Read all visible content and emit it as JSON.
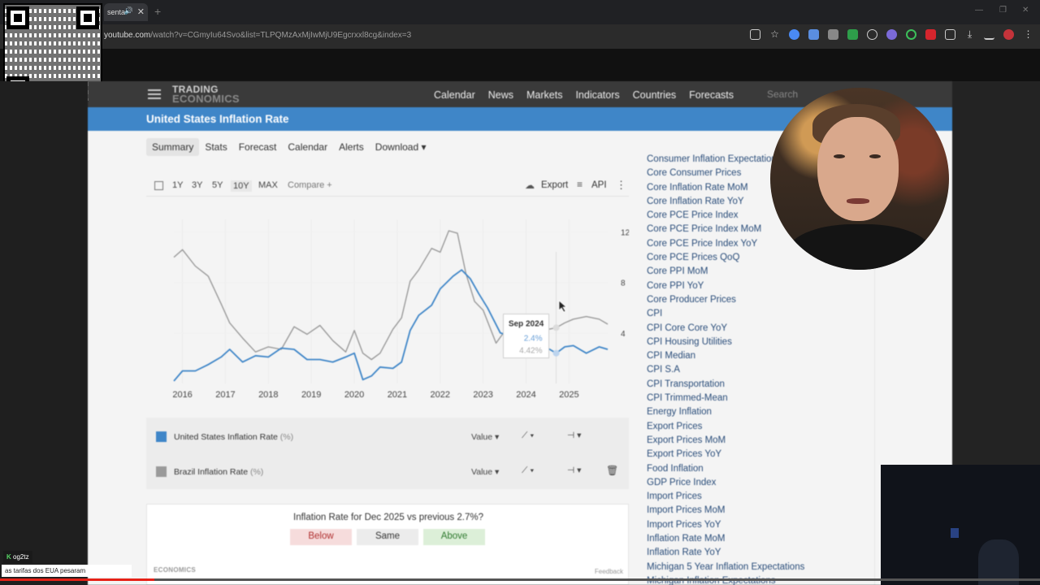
{
  "browser": {
    "tab_title": "senta",
    "url_host": "youtube.com",
    "url_path": "/watch?v=CGmyIu64Svo&list=TLPQMzAxMjIwMjU9Egcrxxl8cg&index=3"
  },
  "site": {
    "logo_line1": "TRADING",
    "logo_line2": "ECONOMICS",
    "nav": [
      "Calendar",
      "News",
      "Markets",
      "Indicators",
      "Countries",
      "Forecasts"
    ],
    "search_placeholder": "Search",
    "page_title": "United States Inflation Rate",
    "subtabs": [
      "Summary",
      "Stats",
      "Forecast",
      "Calendar",
      "Alerts",
      "Download ▾"
    ],
    "active_subtab": "Summary"
  },
  "toolbar": {
    "ranges": [
      "1Y",
      "3Y",
      "5Y",
      "10Y",
      "MAX"
    ],
    "selected_range": "10Y",
    "compare_label": "Compare +",
    "export_label": "Export",
    "api_label": "API"
  },
  "tooltip": {
    "date": "Sep 2024",
    "us_value": "2.4%",
    "br_value": "4.42%"
  },
  "legend": {
    "items": [
      {
        "name": "United States Inflation Rate",
        "unit": "(%)",
        "color": "#3f86c8",
        "value_label": "Value ▾"
      },
      {
        "name": "Brazil Inflation Rate",
        "unit": "(%)",
        "color": "#9a9a9a",
        "value_label": "Value ▾"
      }
    ]
  },
  "poll": {
    "question": "Inflation Rate for Dec 2025 vs previous 2.7%?",
    "below": "Below",
    "same": "Same",
    "above": "Above",
    "footer_logo": "ECONOMICS",
    "feedback": "Feedback"
  },
  "sidebar_list": [
    "Consumer Inflation Expectations",
    "Core Consumer Prices",
    "Core Inflation Rate MoM",
    "Core Inflation Rate YoY",
    "Core PCE Price Index",
    "Core PCE Price Index MoM",
    "Core PCE Price Index YoY",
    "Core PCE Prices QoQ",
    "Core PPI MoM",
    "Core PPI YoY",
    "Core Producer Prices",
    "CPI",
    "CPI Core Core YoY",
    "CPI Housing Utilities",
    "CPI Median",
    "CPI S.A",
    "CPI Transportation",
    "CPI Trimmed-Mean",
    "Energy Inflation",
    "Export Prices",
    "Export Prices MoM",
    "Export Prices YoY",
    "Food Inflation",
    "GDP Price Index",
    "Import Prices",
    "Import Prices MoM",
    "Import Prices YoY",
    "Inflation Rate MoM",
    "Inflation Rate YoY",
    "Michigan 5 Year Inflation Expectations",
    "Michigan Inflation Expectations"
  ],
  "chat": {
    "user": "og2tz",
    "message": "as tarifas dos EUA pesaram"
  },
  "chart_data": {
    "type": "line",
    "x_ticks": [
      "2016",
      "2017",
      "2018",
      "2019",
      "2020",
      "2021",
      "2022",
      "2023",
      "2024",
      "2025"
    ],
    "y_ticks": [
      4,
      8,
      12
    ],
    "ylim": [
      0,
      13
    ],
    "xlim": [
      2015.8,
      2025.9
    ],
    "series": [
      {
        "name": "United States Inflation Rate",
        "color": "#3f86c8",
        "x": [
          2015.8,
          2016.0,
          2016.3,
          2016.6,
          2016.9,
          2017.1,
          2017.4,
          2017.7,
          2018.0,
          2018.3,
          2018.6,
          2018.9,
          2019.2,
          2019.5,
          2019.8,
          2020.0,
          2020.2,
          2020.4,
          2020.6,
          2020.9,
          2021.1,
          2021.3,
          2021.5,
          2021.8,
          2022.0,
          2022.3,
          2022.5,
          2022.7,
          2022.9,
          2023.1,
          2023.4,
          2023.7,
          2023.9,
          2024.1,
          2024.4,
          2024.7,
          2024.9,
          2025.1,
          2025.4,
          2025.7,
          2025.9
        ],
        "y": [
          0.2,
          1.0,
          1.0,
          1.5,
          2.1,
          2.7,
          1.7,
          2.2,
          2.1,
          2.8,
          2.7,
          1.9,
          1.9,
          1.7,
          2.1,
          2.4,
          0.3,
          0.6,
          1.3,
          1.2,
          1.7,
          4.2,
          5.4,
          6.2,
          7.5,
          8.5,
          9.0,
          8.3,
          7.1,
          6.0,
          4.0,
          3.7,
          3.1,
          3.2,
          3.0,
          2.4,
          2.9,
          3.0,
          2.4,
          2.9,
          2.7
        ]
      },
      {
        "name": "Brazil Inflation Rate",
        "color": "#9a9a9a",
        "x": [
          2015.8,
          2016.0,
          2016.3,
          2016.6,
          2016.9,
          2017.1,
          2017.4,
          2017.7,
          2018.0,
          2018.3,
          2018.6,
          2018.9,
          2019.2,
          2019.5,
          2019.8,
          2020.0,
          2020.2,
          2020.4,
          2020.6,
          2020.9,
          2021.1,
          2021.3,
          2021.5,
          2021.8,
          2022.0,
          2022.2,
          2022.4,
          2022.6,
          2022.8,
          2023.0,
          2023.3,
          2023.6,
          2023.9,
          2024.1,
          2024.4,
          2024.7,
          2024.9,
          2025.1,
          2025.4,
          2025.7,
          2025.9
        ],
        "y": [
          10.0,
          10.6,
          9.3,
          8.5,
          6.3,
          4.8,
          3.6,
          2.5,
          2.9,
          2.7,
          4.5,
          3.9,
          4.6,
          3.4,
          2.5,
          4.2,
          2.4,
          1.9,
          2.4,
          4.3,
          5.2,
          8.1,
          9.0,
          10.7,
          10.4,
          12.1,
          11.9,
          8.7,
          6.5,
          5.8,
          3.2,
          4.6,
          4.6,
          4.5,
          4.2,
          4.42,
          4.8,
          5.1,
          5.3,
          5.1,
          4.7
        ]
      }
    ]
  }
}
